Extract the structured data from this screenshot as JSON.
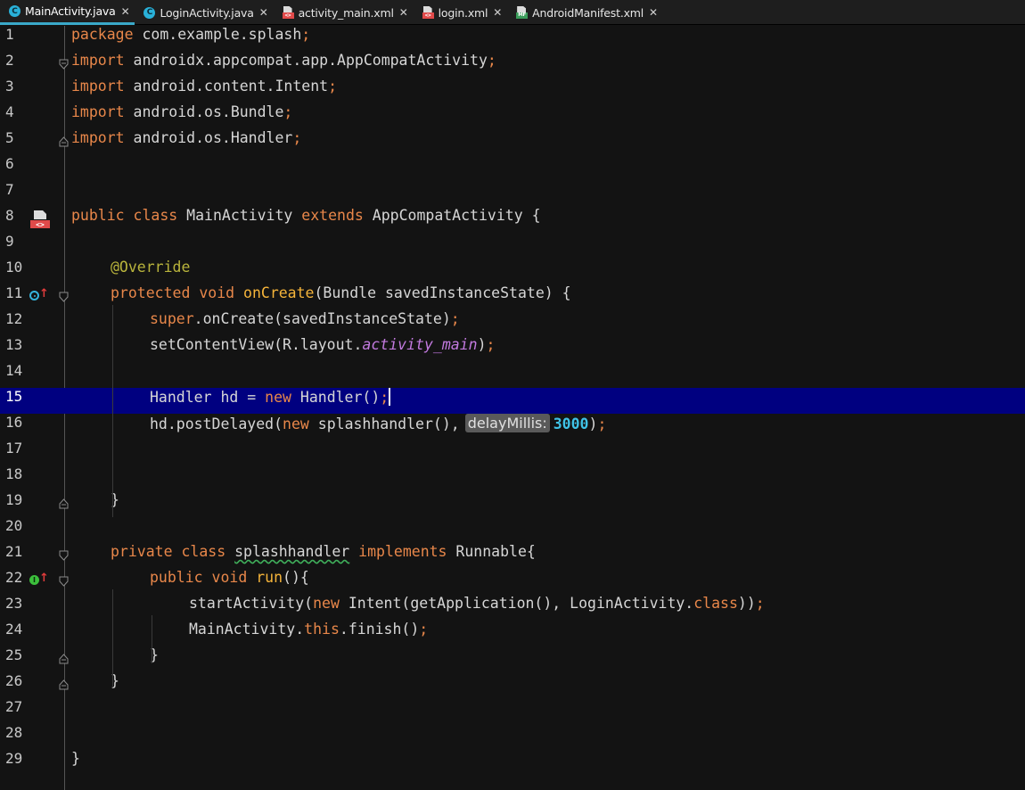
{
  "tabs": [
    {
      "label": "MainActivity.java",
      "type": "java",
      "active": true
    },
    {
      "label": "LoginActivity.java",
      "type": "java",
      "active": false
    },
    {
      "label": "activity_main.xml",
      "type": "xml",
      "active": false
    },
    {
      "label": "login.xml",
      "type": "xml",
      "active": false
    },
    {
      "label": "AndroidManifest.xml",
      "type": "manifest",
      "active": false
    }
  ],
  "close_glyph": "✕",
  "editor": {
    "current_line": 15,
    "lines": [
      {
        "n": "1"
      },
      {
        "n": "2"
      },
      {
        "n": "3"
      },
      {
        "n": "4"
      },
      {
        "n": "5"
      },
      {
        "n": "6"
      },
      {
        "n": "7"
      },
      {
        "n": "8"
      },
      {
        "n": "9"
      },
      {
        "n": "10"
      },
      {
        "n": "11"
      },
      {
        "n": "12"
      },
      {
        "n": "13"
      },
      {
        "n": "14"
      },
      {
        "n": "15"
      },
      {
        "n": "16"
      },
      {
        "n": "17"
      },
      {
        "n": "18"
      },
      {
        "n": "19"
      },
      {
        "n": "20"
      },
      {
        "n": "21"
      },
      {
        "n": "22"
      },
      {
        "n": "23"
      },
      {
        "n": "24"
      },
      {
        "n": "25"
      },
      {
        "n": "26"
      },
      {
        "n": "27"
      },
      {
        "n": "28"
      },
      {
        "n": "29"
      }
    ],
    "code": {
      "l1_kw": "package",
      "l1_rest": " com.example.splash",
      "l1_end": ";",
      "l2_kw": "import",
      "l2_rest": " androidx.appcompat.app.AppCompatActivity",
      "l2_end": ";",
      "l3_kw": "import",
      "l3_rest": " android.content.Intent",
      "l3_end": ";",
      "l4_kw": "import",
      "l4_rest": " android.os.Bundle",
      "l4_end": ";",
      "l5_kw": "import",
      "l5_rest": " android.os.Handler",
      "l5_end": ";",
      "l8_kw1": "public class",
      "l8_name": " MainActivity ",
      "l8_kw2": "extends",
      "l8_rest": " AppCompatActivity {",
      "l10_ann": "@Override",
      "l11_kw": "protected void",
      "l11_fn": "onCreate",
      "l11_rest": "(Bundle savedInstanceState) {",
      "l12_kw": "super",
      "l12_rest": ".onCreate(savedInstanceState)",
      "l12_end": ";",
      "l13_a": "setContentView(R.layout.",
      "l13_fld": "activity_main",
      "l13_b": ")",
      "l13_end": ";",
      "l15_a": "Handler hd = ",
      "l15_kw": "new",
      "l15_b": " Handler()",
      "l15_end": ";",
      "l16_a": "hd.postDelayed(",
      "l16_kw": "new",
      "l16_b": " splashhandler(),",
      "l16_hint": "delayMillis:",
      "l16_num": "3000",
      "l16_c": ")",
      "l16_end": ";",
      "l19": "}",
      "l21_kw1": "private class",
      "l21_name": "splashhandler",
      "l21_kw2": "implements",
      "l21_rest": " Runnable{",
      "l22_kw": "public void",
      "l22_fn": "run",
      "l22_rest": "(){",
      "l23_a": "startActivity(",
      "l23_kw": "new",
      "l23_b": " Intent(getApplication(), LoginActivity.",
      "l23_kw2": "class",
      "l23_c": "))",
      "l23_end": ";",
      "l24_a": "MainActivity.",
      "l24_kw": "this",
      "l24_b": ".finish()",
      "l24_end": ";",
      "l25": "}",
      "l26": "}",
      "l29": "}"
    },
    "gutter_icons": {
      "l11_override": "I",
      "l22_implements": "I",
      "arrow": "↑"
    }
  },
  "colors": {
    "background": "#131313",
    "current_line": "#000080",
    "keyword": "#e8874a",
    "function": "#f5b43a",
    "annotation": "#b9b43c",
    "field": "#c27adf",
    "number": "#3fc2e6",
    "tab_accent": "#3aa9c9"
  }
}
